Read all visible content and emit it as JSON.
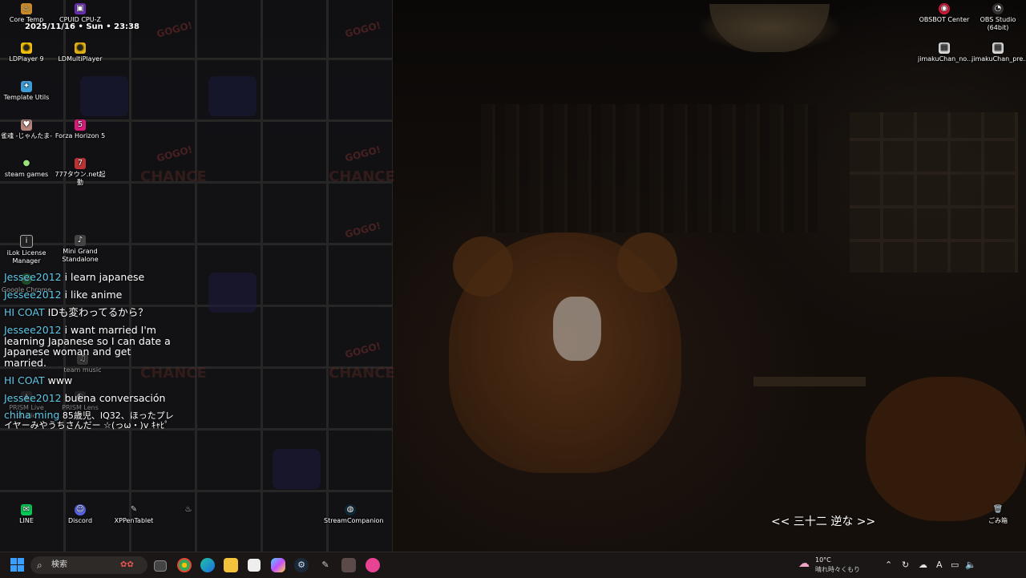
{
  "desktop_overlay": {
    "datetime": "2025/11/16 • Sun • 23:38"
  },
  "desktop_icons": {
    "core_temp": "Core Temp",
    "cpuid": "CPUID CPU-Z",
    "ldplayer": "LDPlayer 9",
    "ldmultiplayer": "LDMultiPlayer",
    "template_utils": "Template Utils",
    "kanryu": "雀魂 -じゃんたま-",
    "forza": "Forza Horizon 5",
    "steam_games": "steam games",
    "777town": "777タウン.net起動",
    "ilok": "iLok License Manager",
    "mini_grand": "Mini Grand Standalone",
    "google_chrome": "Google Chrome",
    "steam_music": "team music",
    "prism_live": "PRISM Live Studio",
    "prism_lens": "PRISM Lens",
    "line": "LINE",
    "discord": "Discord",
    "xppen": "XPPenTablet",
    "streamcompanion": "StreamCompanion",
    "obsbot": "OBSBOT Center",
    "obs_studio": "OBS Studio (64bit)",
    "jimaku_no": "jimakuChan_no...",
    "jimaku_pre": "jimakuChan_pre...",
    "recycle_bin": "ごみ箱"
  },
  "chat": {
    "messages": [
      {
        "user": "Jessee2012",
        "text": "i learn japanese"
      },
      {
        "user": "Jessee2012",
        "text": "i like anime"
      },
      {
        "user": "HI COAT",
        "text": "IDも変わってるから？"
      },
      {
        "user": "Jessee2012",
        "text": "i want married I'm learning Japanese so I can date a Japanese woman and get married."
      },
      {
        "user": "HI COAT",
        "text": "www"
      },
      {
        "user": "Jessee2012",
        "text": "buena conversación"
      },
      {
        "user": "chiha ming",
        "text": "85歳児、IQ32、ほったプレイヤーみやうちさんだー ☆(っω・)v ｷｬﾋﾟ"
      }
    ]
  },
  "now_playing": "<< 三十二 逆な >>",
  "taskbar": {
    "search_placeholder": "検索",
    "weather_temp": "10°C",
    "weather_desc": "晴れ時々くもり",
    "ime_label": "A"
  },
  "colors": {
    "username": "#5ec8e6",
    "accent": "#3aa0ff"
  }
}
